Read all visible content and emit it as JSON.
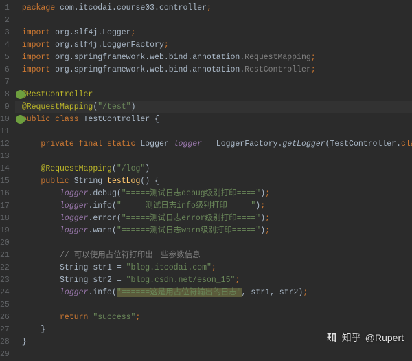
{
  "lines": [
    {
      "n": 1,
      "segs": [
        {
          "t": "package ",
          "c": "kw"
        },
        {
          "t": "com.itcodai.course03.controller",
          "c": "pkg"
        },
        {
          "t": ";",
          "c": "semi"
        }
      ]
    },
    {
      "n": 2,
      "segs": []
    },
    {
      "n": 3,
      "segs": [
        {
          "t": "import ",
          "c": "kw"
        },
        {
          "t": "org.slf4j.Logger",
          "c": "pkg"
        },
        {
          "t": ";",
          "c": "semi"
        }
      ]
    },
    {
      "n": 4,
      "segs": [
        {
          "t": "import ",
          "c": "kw"
        },
        {
          "t": "org.slf4j.LoggerFactory",
          "c": "pkg"
        },
        {
          "t": ";",
          "c": "semi"
        }
      ]
    },
    {
      "n": 5,
      "segs": [
        {
          "t": "import ",
          "c": "kw"
        },
        {
          "t": "org.springframework.web.bind.annotation.",
          "c": "pkg"
        },
        {
          "t": "RequestMapping",
          "c": "imp-gray"
        },
        {
          "t": ";",
          "c": "semi"
        }
      ]
    },
    {
      "n": 6,
      "segs": [
        {
          "t": "import ",
          "c": "kw"
        },
        {
          "t": "org.springframework.web.bind.annotation.",
          "c": "pkg"
        },
        {
          "t": "RestController",
          "c": "imp-gray"
        },
        {
          "t": ";",
          "c": "semi"
        }
      ]
    },
    {
      "n": 7,
      "segs": []
    },
    {
      "n": 8,
      "segs": [
        {
          "t": "@RestController",
          "c": "ann"
        }
      ],
      "icon": true
    },
    {
      "n": 9,
      "segs": [
        {
          "t": "@RequestMapping",
          "c": "ann"
        },
        {
          "t": "(",
          "c": "paren"
        },
        {
          "t": "\"/test\"",
          "c": "str"
        },
        {
          "t": ")",
          "c": "paren"
        }
      ],
      "hl": true
    },
    {
      "n": 10,
      "segs": [
        {
          "t": "public class ",
          "c": "kw"
        },
        {
          "t": "TestController",
          "c": "cls cls-u"
        },
        {
          "t": " {",
          "c": "paren"
        }
      ],
      "icon": true
    },
    {
      "n": 11,
      "segs": []
    },
    {
      "n": 12,
      "segs": [
        {
          "t": "    ",
          "c": ""
        },
        {
          "t": "private final static ",
          "c": "kw"
        },
        {
          "t": "Logger ",
          "c": "cls"
        },
        {
          "t": "logger",
          "c": "log-var"
        },
        {
          "t": " = LoggerFactory.",
          "c": "pkg"
        },
        {
          "t": "getLogger",
          "c": "static-m"
        },
        {
          "t": "(TestController.",
          "c": "paren"
        },
        {
          "t": "class",
          "c": "kw"
        },
        {
          "t": ")",
          "c": "paren"
        },
        {
          "t": ";",
          "c": "semi"
        }
      ]
    },
    {
      "n": 13,
      "segs": []
    },
    {
      "n": 14,
      "segs": [
        {
          "t": "    ",
          "c": ""
        },
        {
          "t": "@RequestMapping",
          "c": "ann"
        },
        {
          "t": "(",
          "c": "paren"
        },
        {
          "t": "\"/log\"",
          "c": "str"
        },
        {
          "t": ")",
          "c": "paren"
        }
      ]
    },
    {
      "n": 15,
      "segs": [
        {
          "t": "    ",
          "c": ""
        },
        {
          "t": "public ",
          "c": "kw"
        },
        {
          "t": "String ",
          "c": "cls"
        },
        {
          "t": "testLog",
          "c": "method"
        },
        {
          "t": "() {",
          "c": "paren"
        }
      ]
    },
    {
      "n": 16,
      "segs": [
        {
          "t": "        ",
          "c": ""
        },
        {
          "t": "logger",
          "c": "log-var"
        },
        {
          "t": ".debug(",
          "c": "paren"
        },
        {
          "t": "\"=====测试日志debug级别打印====\"",
          "c": "str"
        },
        {
          "t": ")",
          "c": "paren"
        },
        {
          "t": ";",
          "c": "semi"
        }
      ]
    },
    {
      "n": 17,
      "segs": [
        {
          "t": "        ",
          "c": ""
        },
        {
          "t": "logger",
          "c": "log-var"
        },
        {
          "t": ".info(",
          "c": "paren"
        },
        {
          "t": "\"=====测试日志info级别打印=====\"",
          "c": "str"
        },
        {
          "t": ")",
          "c": "paren"
        },
        {
          "t": ";",
          "c": "semi"
        }
      ]
    },
    {
      "n": 18,
      "segs": [
        {
          "t": "        ",
          "c": ""
        },
        {
          "t": "logger",
          "c": "log-var"
        },
        {
          "t": ".error(",
          "c": "paren"
        },
        {
          "t": "\"=====测试日志error级别打印====\"",
          "c": "str"
        },
        {
          "t": ")",
          "c": "paren"
        },
        {
          "t": ";",
          "c": "semi"
        }
      ]
    },
    {
      "n": 19,
      "segs": [
        {
          "t": "        ",
          "c": ""
        },
        {
          "t": "logger",
          "c": "log-var"
        },
        {
          "t": ".warn(",
          "c": "paren"
        },
        {
          "t": "\"======测试日志warn级别打印=====\"",
          "c": "str"
        },
        {
          "t": ")",
          "c": "paren"
        },
        {
          "t": ";",
          "c": "semi"
        }
      ]
    },
    {
      "n": 20,
      "segs": []
    },
    {
      "n": 21,
      "segs": [
        {
          "t": "        ",
          "c": ""
        },
        {
          "t": "// 可以使用占位符打印出一些参数信息",
          "c": "comment"
        }
      ]
    },
    {
      "n": 22,
      "segs": [
        {
          "t": "        ",
          "c": ""
        },
        {
          "t": "String ",
          "c": "cls"
        },
        {
          "t": "str1 = ",
          "c": "pkg"
        },
        {
          "t": "\"blog.itcodai.com\"",
          "c": "str"
        },
        {
          "t": ";",
          "c": "semi"
        }
      ]
    },
    {
      "n": 23,
      "segs": [
        {
          "t": "        ",
          "c": ""
        },
        {
          "t": "String ",
          "c": "cls"
        },
        {
          "t": "str2 = ",
          "c": "pkg"
        },
        {
          "t": "\"blog.csdn.net/eson_15\"",
          "c": "str"
        },
        {
          "t": ";",
          "c": "semi"
        }
      ]
    },
    {
      "n": 24,
      "segs": [
        {
          "t": "        ",
          "c": ""
        },
        {
          "t": "logger",
          "c": "log-var"
        },
        {
          "t": ".info(",
          "c": "paren"
        },
        {
          "t": "\"======这是用占位符输出的日志\"",
          "c": "str-hl"
        },
        {
          "t": ", str1, str2)",
          "c": "paren"
        },
        {
          "t": ";",
          "c": "semi"
        }
      ]
    },
    {
      "n": 25,
      "segs": []
    },
    {
      "n": 26,
      "segs": [
        {
          "t": "        ",
          "c": ""
        },
        {
          "t": "return ",
          "c": "kw"
        },
        {
          "t": "\"success\"",
          "c": "str"
        },
        {
          "t": ";",
          "c": "semi"
        }
      ]
    },
    {
      "n": 27,
      "segs": [
        {
          "t": "    }",
          "c": "paren"
        }
      ]
    },
    {
      "n": 28,
      "segs": [
        {
          "t": "}",
          "c": "paren"
        }
      ]
    },
    {
      "n": 29,
      "segs": []
    }
  ],
  "watermark": {
    "platform": "知乎",
    "author": "@Rupert"
  }
}
